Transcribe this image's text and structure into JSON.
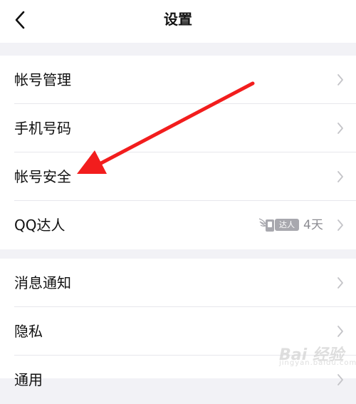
{
  "header": {
    "title": "设置",
    "back_icon": "chevron-left-icon"
  },
  "groups": [
    {
      "items": [
        {
          "label": "帐号管理",
          "icon": "chevron-right-icon"
        },
        {
          "label": "手机号码",
          "icon": "chevron-right-icon"
        },
        {
          "label": "帐号安全",
          "icon": "chevron-right-icon"
        },
        {
          "label": "QQ达人",
          "badge": "达人",
          "days": "4天",
          "icon": "chevron-right-icon"
        }
      ]
    },
    {
      "items": [
        {
          "label": "消息通知",
          "icon": "chevron-right-icon"
        },
        {
          "label": "隐私",
          "icon": "chevron-right-icon"
        },
        {
          "label": "通用",
          "icon": "chevron-right-icon"
        }
      ]
    }
  ],
  "annotation": {
    "type": "red-arrow",
    "color": "#f21d1d",
    "points_to": "帐号安全"
  },
  "watermark": {
    "text": "Bai 经验",
    "sub": "jingyan.baidu.com"
  },
  "colors": {
    "background": "#f2f2f6",
    "row": "#ffffff",
    "chevron": "#c4c4c8",
    "divider": "#e7e7ec"
  }
}
